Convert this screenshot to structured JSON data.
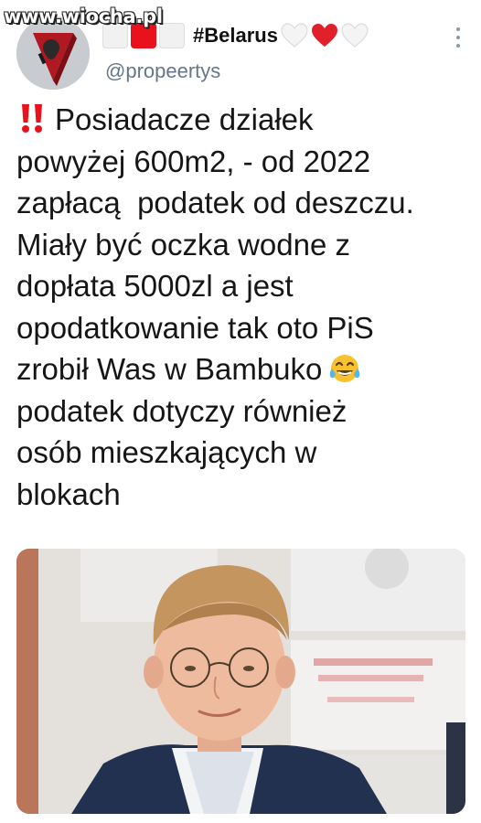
{
  "watermark": "www.wiocha.pl",
  "tweet": {
    "display_name": "#Belarus",
    "handle": "@propeertys",
    "lines": [
      "Posiadacze działek",
      "powyżej 600m2, - od 2022",
      "zapłacą  podatek od deszczu.",
      "Miały być oczka wodne z",
      "dopłata 5000zl a jest",
      "opodatkowanie tak oto PiS",
      "zrobił Was w Bambuko",
      "podatek dotyczy również",
      "osób mieszkających w",
      "blokach"
    ]
  },
  "colors": {
    "flag_red": "#e8111c",
    "flag_white": "#f1f1f1",
    "heart_red": "#e0202a",
    "handle_gray": "#657786"
  },
  "icons": {
    "bangbang": "double-exclamation-icon",
    "emoji": "tears-of-joy-emoji-icon",
    "menu": "vertical-ellipsis-icon"
  }
}
